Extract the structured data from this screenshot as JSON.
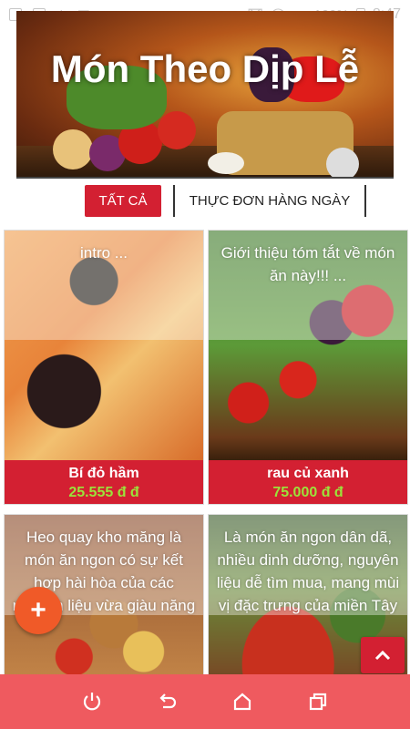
{
  "status_bar": {
    "battery": "100%",
    "time": "8:47"
  },
  "hero": {
    "title": "Món Theo Dịp Lễ"
  },
  "tabs": {
    "all_label": "TẤT CẢ",
    "daily_label": "THỰC ĐƠN HÀNG NGÀY"
  },
  "cards": [
    {
      "intro": "intro ...",
      "name": "Bí đỏ hầm",
      "price": "25.555 đ đ"
    },
    {
      "intro": "Giới thiệu tóm tắt về món ăn này!!! ...",
      "name": "rau củ xanh",
      "price": "75.000 đ đ"
    },
    {
      "intro": "Heo quay kho măng là món ăn ngon có sự kết hợp hài hòa của các nguyên liệu vừa giàu năng"
    },
    {
      "intro": "Là món ăn ngon dân dã, nhiều dinh dưỡng, nguyên liệu dễ tìm mua, mang mùi vị đặc trưng của miền Tây"
    }
  ],
  "fab": {
    "label": "+"
  },
  "colors": {
    "primary_red": "#d32032",
    "nav_bar": "#ef5a5f",
    "price_green": "#9be33a",
    "fab_orange": "#f05a28"
  },
  "icons": {
    "power": "power-icon",
    "back": "back-icon",
    "home": "home-icon",
    "recents": "recents-icon",
    "scroll_top": "chevron-up-icon"
  }
}
